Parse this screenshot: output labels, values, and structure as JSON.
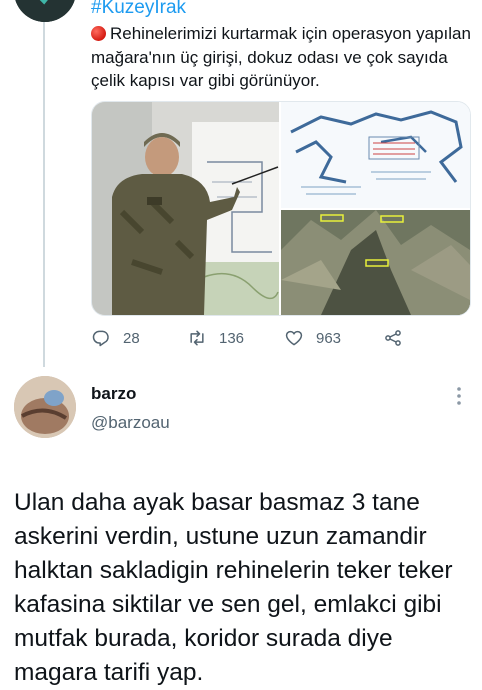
{
  "tweet": {
    "hashtag": "#KuzeyIrak",
    "text": "Rehinelerimizi kurtarmak için operasyon yapılan mağara'nın üç girişi, dokuz odası ve çok sayıda çelik kapısı var gibi görünüyor.",
    "actions": {
      "reply_count": "28",
      "retweet_count": "136",
      "like_count": "963"
    }
  },
  "reply": {
    "name": "barzo",
    "handle": "@barzoau",
    "text": "Ulan daha ayak basar basmaz 3 tane askerini verdin, ustune uzun zamandir halktan sakladigin rehinelerin teker teker kafasina siktilar ve sen gel, emlakci gibi mutfak burada, koridor surada diye magara tarifi yap."
  },
  "icons": [
    "red-circle-icon",
    "reply-icon",
    "retweet-icon",
    "like-icon",
    "share-icon",
    "more-options-icon"
  ],
  "colors": {
    "link": "#1d9bf0",
    "secondary_text": "#536471",
    "red_dot": "#e0245e"
  }
}
